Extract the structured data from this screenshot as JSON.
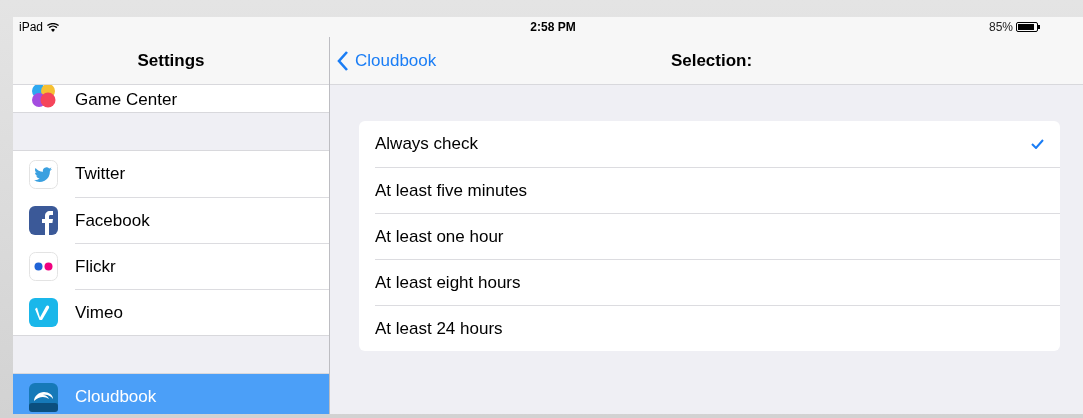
{
  "status_bar": {
    "device": "iPad",
    "time": "2:58 PM",
    "battery": "85%"
  },
  "sidebar": {
    "title": "Settings",
    "groups": [
      [
        {
          "label": "Game Center",
          "kind": "gamecenter",
          "selected": false
        }
      ],
      [
        {
          "label": "Twitter",
          "kind": "twitter",
          "selected": false
        },
        {
          "label": "Facebook",
          "kind": "facebook",
          "selected": false
        },
        {
          "label": "Flickr",
          "kind": "flickr",
          "selected": false
        },
        {
          "label": "Vimeo",
          "kind": "vimeo",
          "selected": false
        }
      ],
      [
        {
          "label": "Cloudbook",
          "kind": "cloudbook",
          "selected": true
        }
      ]
    ]
  },
  "detail": {
    "back": "Cloudbook",
    "title": "Selection:",
    "options": [
      {
        "label": "Always check",
        "selected": true
      },
      {
        "label": "At least five minutes",
        "selected": false
      },
      {
        "label": "At least one hour",
        "selected": false
      },
      {
        "label": "At least eight hours",
        "selected": false
      },
      {
        "label": "At least 24 hours",
        "selected": false
      }
    ]
  }
}
